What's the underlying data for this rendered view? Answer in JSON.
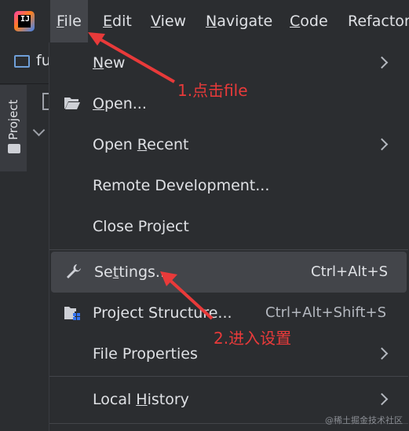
{
  "menubar": {
    "logo_text": "IJ",
    "items": [
      {
        "label": "File",
        "u": "F",
        "rest": "ile"
      },
      {
        "label": "Edit",
        "u": "E",
        "rest": "dit"
      },
      {
        "label": "View",
        "u": "V",
        "rest": "iew"
      },
      {
        "label": "Navigate",
        "u": "N",
        "rest": "avigate"
      },
      {
        "label": "Code",
        "u": "C",
        "rest": "ode"
      },
      {
        "label": "Refactor",
        "u": "",
        "rest": "Refactor"
      }
    ]
  },
  "project": {
    "name_fragment": "fu",
    "side_tab_label": "Project"
  },
  "file_menu": {
    "new": {
      "u": "N",
      "rest": "ew"
    },
    "open": {
      "u": "O",
      "rest": "pen..."
    },
    "open_recent": {
      "pre": "Open ",
      "u": "R",
      "rest": "ecent"
    },
    "remote": "Remote Development...",
    "close": "Close Project",
    "settings": {
      "pre": "Se",
      "u": "t",
      "rest": "tings...",
      "shortcut": "Ctrl+Alt+S"
    },
    "structure": {
      "label": "Project Structure...",
      "shortcut": "Ctrl+Alt+Shift+S"
    },
    "properties": "File Properties",
    "history": {
      "pre": "Local ",
      "u": "H",
      "rest": "istory"
    }
  },
  "annotations": {
    "step1": "1.点击file",
    "step2": "2.进入设置",
    "color": "#e83a3a"
  },
  "watermark": "@稀土掘金技术社区"
}
